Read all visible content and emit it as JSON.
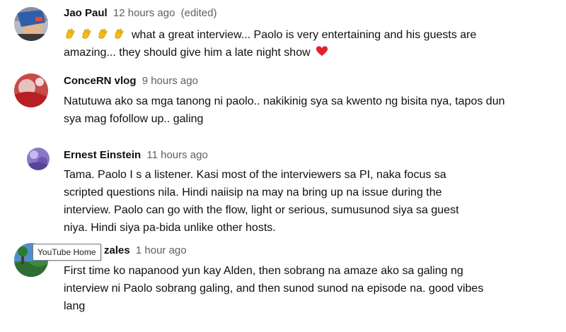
{
  "comments": [
    {
      "author": "Jao Paul",
      "time": "12 hours ago",
      "edited": "(edited)",
      "text_lines": [
        "what a great interview... Paolo is very entertaining and his guests are",
        "amazing... they should give him a late night show"
      ],
      "leading_emoji": "clapping-hands-icon",
      "leading_emoji_count": 4,
      "trailing_emoji": "red-heart-icon"
    },
    {
      "author": "ConceRN vlog",
      "time": "9 hours ago",
      "text_lines": [
        "Natutuwa ako sa mga tanong ni paolo.. nakikinig sya sa kwento ng bisita nya, tapos dun",
        "sya mag fofollow up.. galing"
      ]
    },
    {
      "author": "Ernest Einstein",
      "time": "11 hours ago",
      "text_lines": [
        "Tama. Paolo I s a listener. Kasi most of the interviewers sa PI, naka focus sa",
        "scripted questions nila. Hindi naiisip na may na bring up na issue during the",
        "interview. Paolo can go with the flow, light or serious, sumusunod siya sa guest",
        "niya. Hindi siya pa-bida unlike other hosts."
      ]
    },
    {
      "author": "zales",
      "time": "1 hour ago",
      "text_lines": [
        "First time ko napanood yun kay Alden, then sobrang na amaze ako sa galing ng",
        "interview ni Paolo sobrang galing, and then sunod sunod na episode na. good vibes",
        "lang"
      ]
    }
  ],
  "tooltip": "YouTube Home",
  "colors": {
    "text": "#0f0f0f",
    "meta": "#606060",
    "heart": "#e0242b",
    "clap": "#f6b91a"
  }
}
